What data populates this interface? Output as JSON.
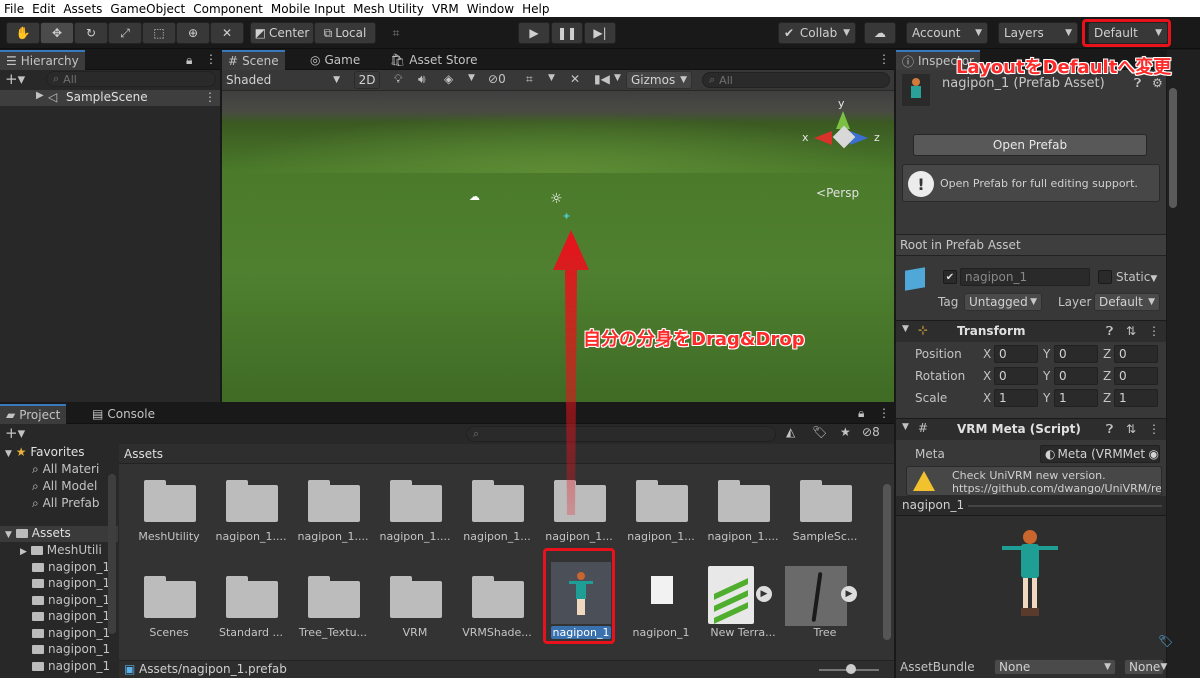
{
  "menubar": [
    "File",
    "Edit",
    "Assets",
    "GameObject",
    "Component",
    "Mobile Input",
    "Mesh Utility",
    "VRM",
    "Window",
    "Help"
  ],
  "toolbar": {
    "pivot_center": "Center",
    "pivot_local": "Local",
    "collab": "Collab",
    "account": "Account",
    "layers": "Layers",
    "layout": "Default"
  },
  "hierarchy": {
    "tab": "Hierarchy",
    "search_placeholder": "All",
    "scene": "SampleScene"
  },
  "scene_view": {
    "tabs": [
      "Scene",
      "Game",
      "Asset Store"
    ],
    "shading": "Shaded",
    "mode_2d": "2D",
    "hidden_count": "0",
    "gizmos": "Gizmos",
    "search_placeholder": "All",
    "gizmo_labels": {
      "x": "x",
      "y": "y",
      "z": "z"
    },
    "persp": "Persp"
  },
  "project": {
    "tabs": [
      "Project",
      "Console"
    ],
    "hidden_count": "8",
    "favorites_title": "Favorites",
    "favorites": [
      "All Materi",
      "All Model",
      "All Prefab"
    ],
    "assets_root": "Assets",
    "asset_tree": [
      "MeshUtili",
      "nagipon_1",
      "nagipon_1",
      "nagipon_1",
      "nagipon_1",
      "nagipon_1",
      "nagipon_1",
      "nagipon_1"
    ],
    "breadcrumb": "Assets",
    "row1": [
      "MeshUtility",
      "nagipon_1....",
      "nagipon_1....",
      "nagipon_1....",
      "nagipon_1...",
      "nagipon_1...",
      "nagipon_1...",
      "nagipon_1....",
      "SampleSc..."
    ],
    "row2": [
      "Scenes",
      "Standard ...",
      "Tree_Textu...",
      "VRM",
      "VRMShade...",
      "nagipon_1",
      "nagipon_1",
      "New Terra...",
      "Tree"
    ],
    "path": "Assets/nagipon_1.prefab"
  },
  "inspector": {
    "tab": "Inspector",
    "asset_name": "nagipon_1 (Prefab Asset)",
    "open_prefab": "Open Prefab",
    "info": "Open Prefab for full editing support.",
    "root_title": "Root in Prefab Asset",
    "object_name": "nagipon_1",
    "static_label": "Static",
    "tag_label": "Tag",
    "tag_value": "Untagged",
    "layer_label": "Layer",
    "layer_value": "Default",
    "transform_title": "Transform",
    "position_label": "Position",
    "rotation_label": "Rotation",
    "scale_label": "Scale",
    "axis": [
      "X",
      "Y",
      "Z"
    ],
    "position": [
      "0",
      "0",
      "0"
    ],
    "rotation": [
      "0",
      "0",
      "0"
    ],
    "scale": [
      "1",
      "1",
      "1"
    ],
    "vrm_title": "VRM Meta (Script)",
    "meta_label": "Meta",
    "meta_value": "Meta (VRMMet",
    "warning_line1": "Check UniVRM new version.",
    "warning_line2": "https://github.com/dwango/UniVRM/rele",
    "preview_title": "nagipon_1",
    "assetbundle_label": "AssetBundle",
    "assetbundle_value": "None",
    "assetbundle_variant": "None"
  },
  "annotations": {
    "layout_note": "LayoutをDefaultへ変更",
    "drag_note": "自分の分身をDrag&Drop"
  },
  "colors": {
    "annotation_red": "#e8121c",
    "accent_blue": "#3a79bb",
    "grass": "#4d7a2c"
  }
}
